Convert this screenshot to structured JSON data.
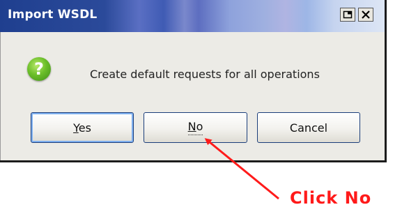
{
  "window": {
    "title": "Import WSDL"
  },
  "dialog": {
    "icon": "question-icon",
    "message": "Create default requests for all operations"
  },
  "buttons": {
    "yes": "Yes",
    "no": "No",
    "cancel": "Cancel"
  },
  "annotation": {
    "text": "Click No",
    "color": "#ff1a1a"
  },
  "colors": {
    "titlebar_start": "#1f3f8f",
    "dialog_bg": "#ecebe6",
    "button_border": "#1a3d7a"
  }
}
